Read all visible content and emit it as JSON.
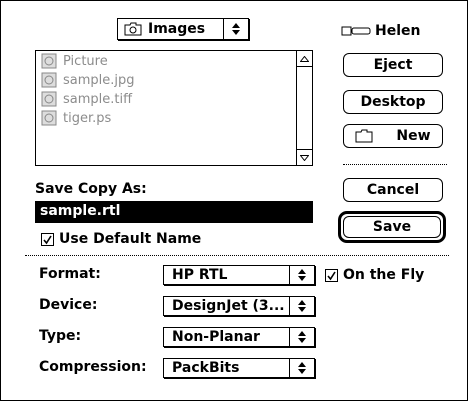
{
  "folder_popup": {
    "label": "Images",
    "icon": "folder-icon"
  },
  "volume": {
    "label": "Helen",
    "icon": "disk-icon"
  },
  "files": [
    {
      "name": "Picture"
    },
    {
      "name": "sample.jpg"
    },
    {
      "name": "sample.tiff"
    },
    {
      "name": "tiger.ps"
    }
  ],
  "buttons": {
    "eject": "Eject",
    "desktop": "Desktop",
    "new": "New",
    "cancel": "Cancel",
    "save": "Save"
  },
  "save_as": {
    "label": "Save Copy As:",
    "value": "sample.rtl"
  },
  "use_default_name": {
    "label": "Use Default Name",
    "checked": true
  },
  "options": {
    "format": {
      "label": "Format:",
      "value": "HP RTL"
    },
    "device": {
      "label": "Device:",
      "value": "DesignJet (3..."
    },
    "type": {
      "label": "Type:",
      "value": "Non-Planar"
    },
    "compression": {
      "label": "Compression:",
      "value": "PackBits"
    }
  },
  "on_the_fly": {
    "label": "On the Fly",
    "checked": true
  }
}
